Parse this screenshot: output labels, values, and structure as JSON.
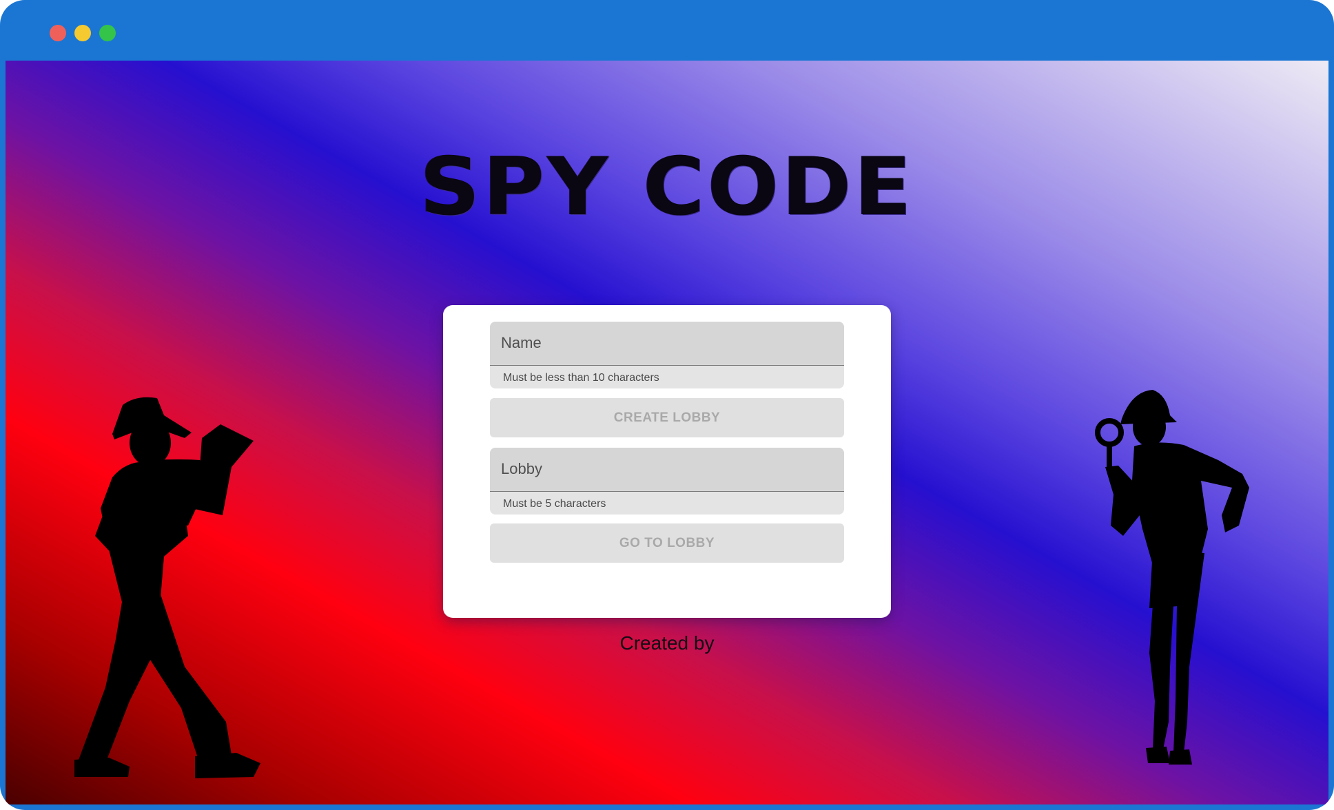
{
  "window": {
    "controls": [
      "close",
      "minimize",
      "maximize"
    ]
  },
  "logo": {
    "title": "SPY CODE"
  },
  "form": {
    "name_field": {
      "placeholder": "Name",
      "hint": "Must be less than 10 characters"
    },
    "create_button": "CREATE LOBBY",
    "lobby_field": {
      "placeholder": "Lobby",
      "hint": "Must be 5 characters"
    },
    "go_button": "GO TO LOBBY"
  },
  "footer": {
    "credit": "Created by"
  },
  "colors": {
    "frame": "#1b76d3",
    "gradient_red": "#ff0010",
    "gradient_blue": "#2610d0",
    "gradient_light": "#eeeaf4",
    "button_disabled_bg": "#e0e0e0",
    "button_disabled_text": "#a9a9a9"
  }
}
